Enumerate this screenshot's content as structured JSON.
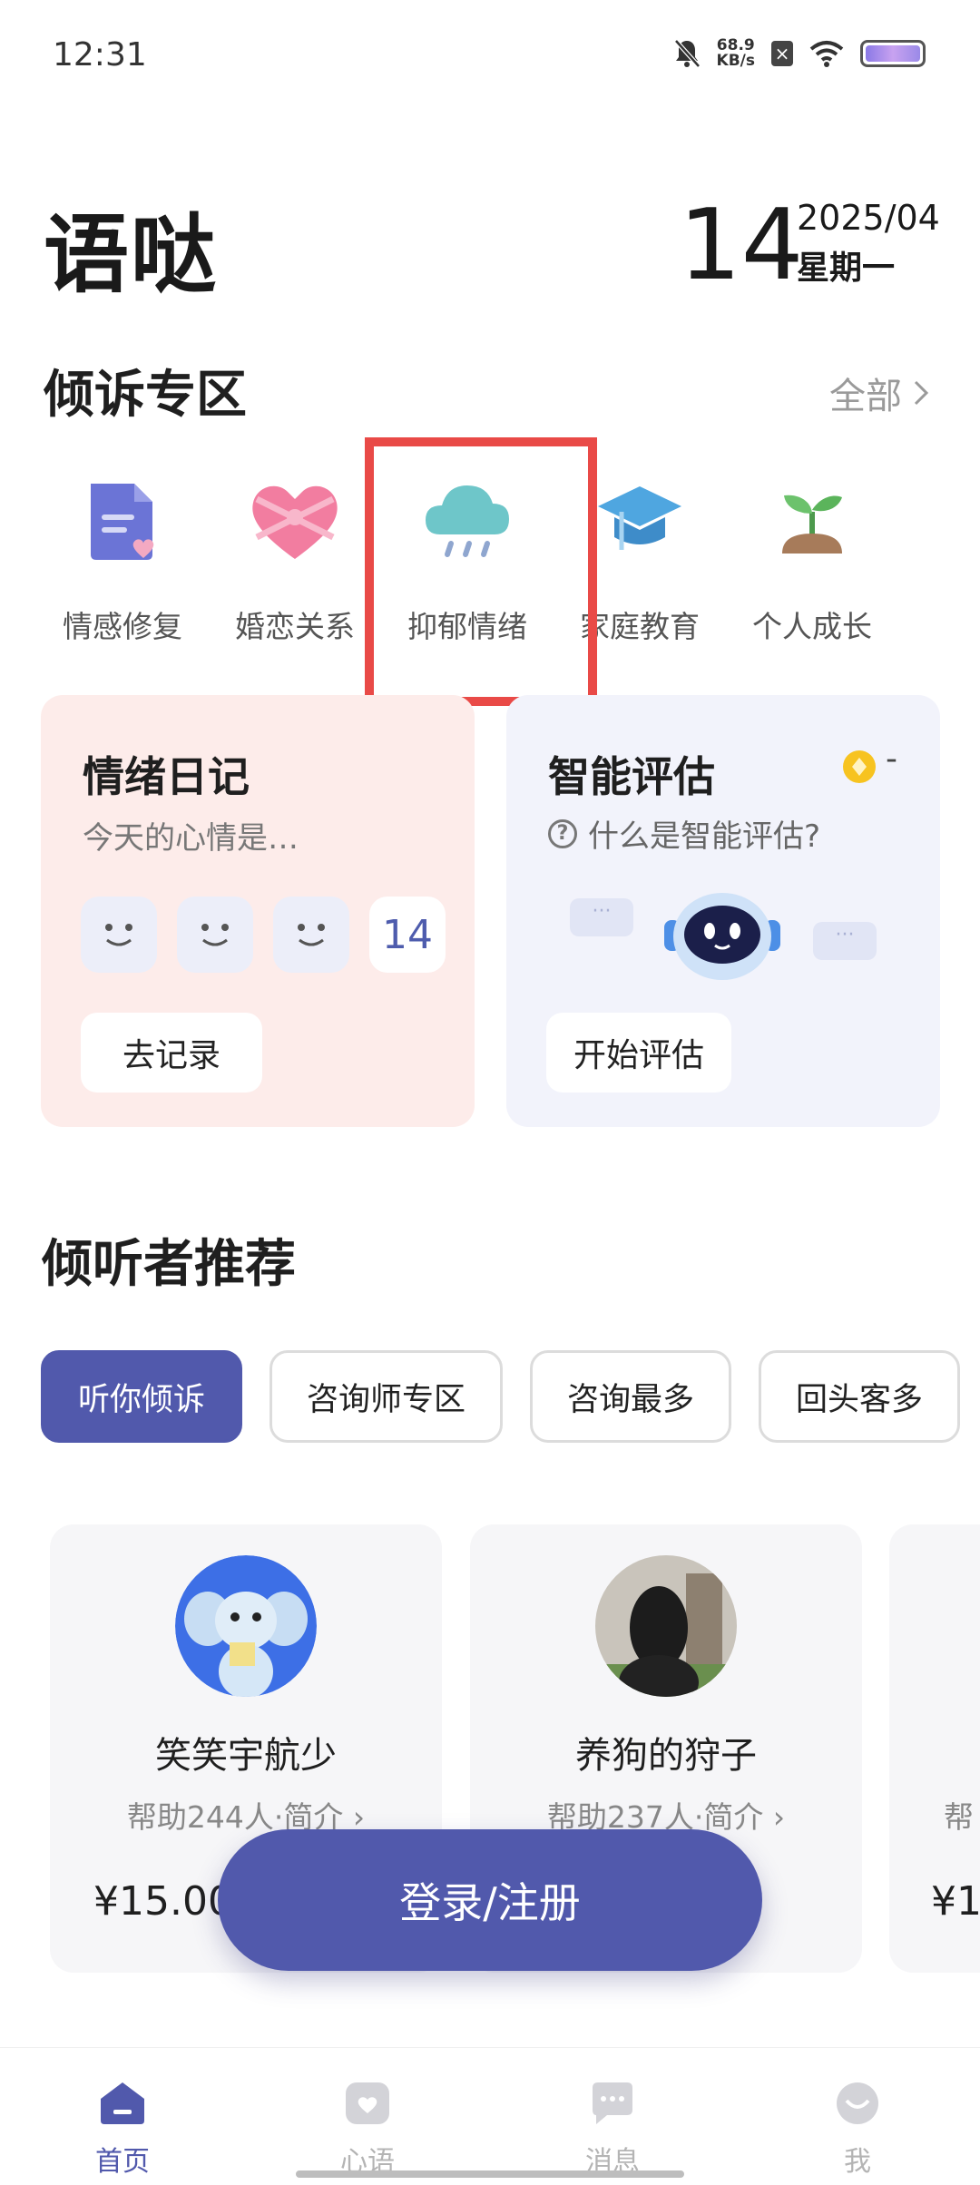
{
  "status_bar": {
    "time": "12:31",
    "net_speed_value": "68.9",
    "net_speed_unit": "KB/s"
  },
  "header": {
    "app_title": "语哒",
    "date_day": "14",
    "date_year_month": "2025/04",
    "date_weekday": "星期一"
  },
  "confide": {
    "title": "倾诉专区",
    "see_all": "全部",
    "categories": [
      {
        "label": "情感修复",
        "icon": "document-heart-icon"
      },
      {
        "label": "婚恋关系",
        "icon": "heart-gift-icon"
      },
      {
        "label": "抑郁情绪",
        "icon": "rain-cloud-icon"
      },
      {
        "label": "家庭教育",
        "icon": "graduation-cap-icon"
      },
      {
        "label": "个人成长",
        "icon": "sprout-icon"
      }
    ]
  },
  "diary_card": {
    "title": "情绪日记",
    "subtitle": "今天的心情是…",
    "count": "14",
    "button": "去记录"
  },
  "eval_card": {
    "title": "智能评估",
    "coin_value": "-",
    "help_text": "什么是智能评估?",
    "button": "开始评估"
  },
  "listeners": {
    "title": "倾听者推荐",
    "tabs": [
      "听你倾诉",
      "咨询师专区",
      "咨询最多",
      "回头客多"
    ],
    "active_tab": "听你倾诉",
    "items": [
      {
        "name": "笑笑宇航少",
        "help": "帮助244人·简介",
        "price": "¥15.00"
      },
      {
        "name": "养狗的狩子",
        "help": "帮助237人·简介",
        "price": "¥"
      },
      {
        "name": "",
        "help": "帮",
        "price": "¥1"
      }
    ]
  },
  "login_button": "登录/注册",
  "bottom_nav": {
    "items": [
      {
        "label": "首页",
        "icon": "home-icon"
      },
      {
        "label": "心语",
        "icon": "heart-chat-icon"
      },
      {
        "label": "消息",
        "icon": "message-icon"
      },
      {
        "label": "我",
        "icon": "profile-icon"
      }
    ],
    "active": "首页"
  },
  "colors": {
    "brand": "#5159ac",
    "highlight": "#e94a47",
    "diary_bg": "#fdecea",
    "eval_bg": "#f2f3fb"
  }
}
